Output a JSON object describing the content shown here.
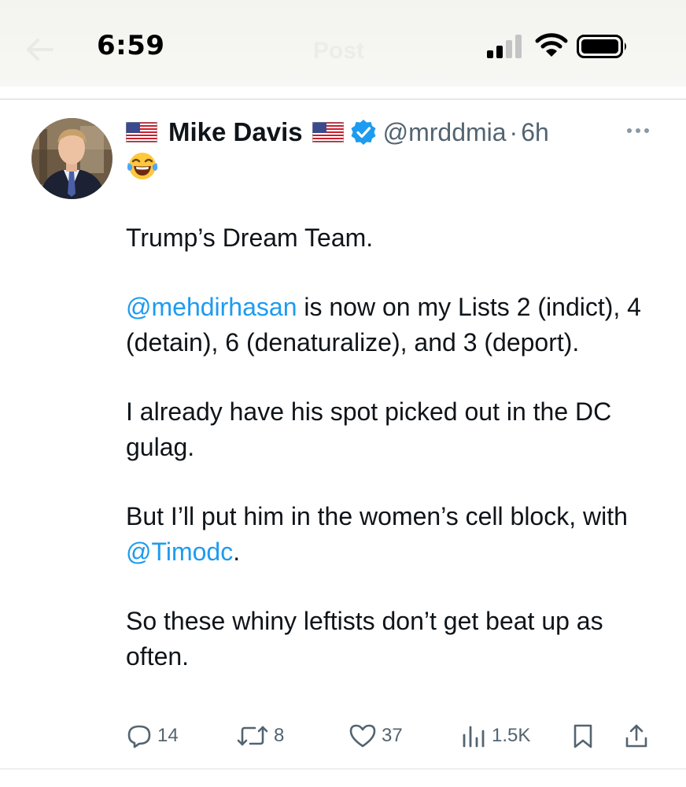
{
  "status_bar": {
    "time": "6:59",
    "icons": [
      "cellular-signal-icon",
      "wifi-icon",
      "battery-icon"
    ]
  },
  "header": {
    "title": "Post",
    "back_icon": "back-arrow-icon"
  },
  "tweet": {
    "author": {
      "name": "Mike Davis",
      "handle": "@mrddmia",
      "time_ago": "6h",
      "separator": "·",
      "verified": true,
      "name_emoji_left": "us-flag-icon",
      "name_emoji_right": "us-flag-icon"
    },
    "reaction_emoji": "laughing-tears-emoji",
    "paragraphs": [
      {
        "segments": [
          {
            "text": "Trump’s Dream Team.",
            "mention": false
          }
        ]
      },
      {
        "segments": [
          {
            "text": "@mehdirhasan",
            "mention": true
          },
          {
            "text": " is now on my Lists 2 (indict), 4 (detain), 6 (denaturalize), and 3 (deport).",
            "mention": false
          }
        ]
      },
      {
        "segments": [
          {
            "text": "I already have his spot picked out in the DC gulag.",
            "mention": false
          }
        ]
      },
      {
        "segments": [
          {
            "text": "But I’ll put him in the women’s cell block, with ",
            "mention": false
          },
          {
            "text": "@Timodc",
            "mention": true
          },
          {
            "text": ".",
            "mention": false
          }
        ]
      },
      {
        "segments": [
          {
            "text": "So these whiny leftists don’t get beat up as often.",
            "mention": false
          }
        ]
      }
    ],
    "actions": {
      "replies": "14",
      "reposts": "8",
      "likes": "37",
      "views": "1.5K"
    }
  },
  "colors": {
    "mention": "#1d9bf0",
    "secondary_text": "#536471",
    "verified": "#1d9bf0"
  }
}
